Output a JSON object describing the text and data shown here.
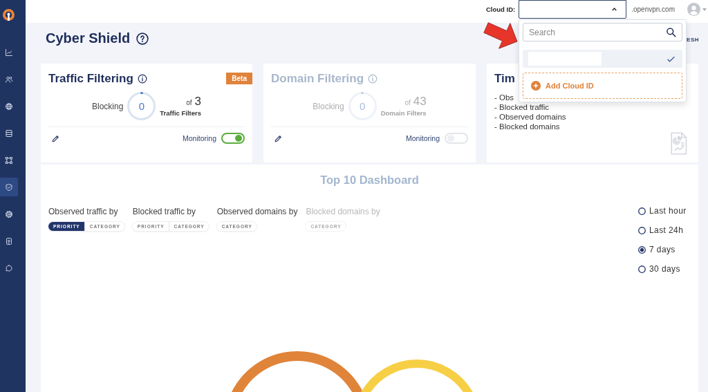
{
  "sidebar": {
    "items": [
      {
        "selected": false
      },
      {
        "selected": false
      },
      {
        "selected": false
      },
      {
        "selected": false
      },
      {
        "selected": false
      },
      {
        "selected": true
      },
      {
        "selected": false
      },
      {
        "selected": false
      },
      {
        "selected": false
      }
    ]
  },
  "top_bar": {
    "cloud_id_label": "Cloud ID:",
    "cloud_id_select": {
      "expanded": true
    },
    "domain_suffix": ".openvpn.com"
  },
  "cloud_id_menu": {
    "search": {
      "placeholder": "Search"
    },
    "items": [
      {
        "selected": true
      }
    ],
    "add_button": "Add Cloud ID"
  },
  "page": {
    "title": "Cyber Shield",
    "refresh_button": "ESH"
  },
  "cards": [
    {
      "title": "Traffic Filtering",
      "disabled": false,
      "badge": "Beta",
      "blocking_label": "Blocking",
      "blocking_count": "0",
      "of_label": "of",
      "total": "3",
      "total_label": "Traffic Filters",
      "monitoring": {
        "label": "Monitoring",
        "on": true
      }
    },
    {
      "title": "Domain Filtering",
      "disabled": true,
      "blocking_label": "Blocking",
      "blocking_count": "0",
      "of_label": "of",
      "total": "43",
      "total_label": "Domain Filters",
      "monitoring": {
        "label": "Monitoring",
        "on": false
      }
    }
  ],
  "info_card": {
    "title": "Tim",
    "items": [
      "- Obs",
      "- Blocked traffic",
      "- Observed domains",
      "- Blocked domains"
    ]
  },
  "dashboard": {
    "title": "Top 10 Dashboard",
    "groups": [
      {
        "label": "Observed traffic by",
        "disabled": false,
        "options": [
          {
            "label": "PRIORITY",
            "selected": true
          },
          {
            "label": "CATEGORY",
            "selected": false
          }
        ]
      },
      {
        "label": "Blocked traffic by",
        "disabled": false,
        "options": [
          {
            "label": "PRIORITY",
            "selected": false
          },
          {
            "label": "CATEGORY",
            "selected": false
          }
        ]
      },
      {
        "label": "Observed domains by",
        "disabled": false,
        "options": [
          {
            "label": "CATEGORY",
            "selected": false
          }
        ]
      },
      {
        "label": "Blocked domains by",
        "disabled": true,
        "options": [
          {
            "label": "CATEGORY",
            "selected": false
          }
        ]
      }
    ],
    "time_ranges": [
      {
        "label": "Last hour",
        "selected": false
      },
      {
        "label": "Last 24h",
        "selected": false
      },
      {
        "label": "7 days",
        "selected": true
      },
      {
        "label": "30 days",
        "selected": false
      }
    ]
  }
}
